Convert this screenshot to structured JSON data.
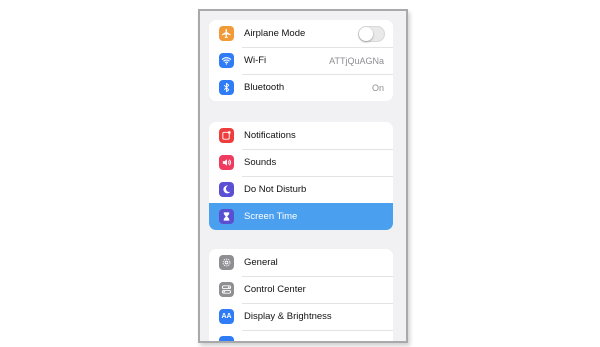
{
  "colors": {
    "selected_row": "#4aa0ef",
    "airplane": "#f19a37",
    "wifi": "#2f7cf6",
    "bluetooth": "#2f7cf6",
    "notifications": "#ee3d3d",
    "sounds": "#ef3b5e",
    "do_not_disturb": "#5b4fd6",
    "screen_time": "#5a4fd1",
    "general": "#8e8e93",
    "control_center": "#8e8e93",
    "display": "#2f7cf6"
  },
  "settings": {
    "group1": [
      {
        "label": "Airplane Mode",
        "icon": "airplane-icon",
        "toggle_on": false
      },
      {
        "label": "Wi-Fi",
        "icon": "wifi-icon",
        "value": "ATTjQuAGNa"
      },
      {
        "label": "Bluetooth",
        "icon": "bluetooth-icon",
        "value": "On"
      }
    ],
    "group2": [
      {
        "label": "Notifications",
        "icon": "notifications-icon"
      },
      {
        "label": "Sounds",
        "icon": "sounds-icon"
      },
      {
        "label": "Do Not Disturb",
        "icon": "moon-icon"
      },
      {
        "label": "Screen Time",
        "icon": "hourglass-icon",
        "selected": true
      }
    ],
    "group3": [
      {
        "label": "General",
        "icon": "gear-icon"
      },
      {
        "label": "Control Center",
        "icon": "control-center-icon"
      },
      {
        "label": "Display & Brightness",
        "icon": "display-brightness-icon",
        "icon_text": "AA"
      }
    ]
  }
}
